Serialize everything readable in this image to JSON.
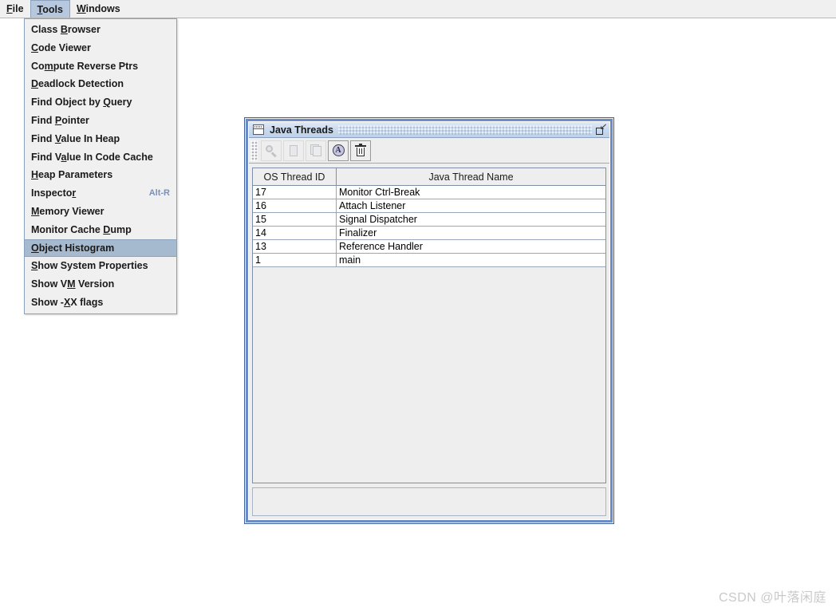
{
  "menubar": {
    "items": [
      {
        "label": "File",
        "mnemonic_index": 0,
        "selected": false
      },
      {
        "label": "Tools",
        "mnemonic_index": 0,
        "selected": true
      },
      {
        "label": "Windows",
        "mnemonic_index": 0,
        "selected": false
      }
    ]
  },
  "tools_menu": {
    "open": true,
    "highlight_color": "#a5b9cf",
    "items": [
      {
        "label": "Class Browser",
        "mnemonic_index": 6,
        "accel": "",
        "highlighted": false
      },
      {
        "label": "Code Viewer",
        "mnemonic_index": 0,
        "accel": "",
        "highlighted": false
      },
      {
        "label": "Compute Reverse Ptrs",
        "mnemonic_index": 2,
        "accel": "",
        "highlighted": false
      },
      {
        "label": "Deadlock Detection",
        "mnemonic_index": 0,
        "accel": "",
        "highlighted": false
      },
      {
        "label": "Find Object by Query",
        "mnemonic_index": 15,
        "accel": "",
        "highlighted": false
      },
      {
        "label": "Find Pointer",
        "mnemonic_index": 5,
        "accel": "",
        "highlighted": false
      },
      {
        "label": "Find Value In Heap",
        "mnemonic_index": 5,
        "accel": "",
        "highlighted": false
      },
      {
        "label": "Find Value In Code Cache",
        "mnemonic_index": 6,
        "accel": "",
        "highlighted": false
      },
      {
        "label": "Heap Parameters",
        "mnemonic_index": 0,
        "accel": "",
        "highlighted": false
      },
      {
        "label": "Inspector",
        "mnemonic_index": 8,
        "accel": "Alt-R",
        "highlighted": false
      },
      {
        "label": "Memory Viewer",
        "mnemonic_index": 0,
        "accel": "",
        "highlighted": false
      },
      {
        "label": "Monitor Cache Dump",
        "mnemonic_index": 14,
        "accel": "",
        "highlighted": false
      },
      {
        "label": "Object Histogram",
        "mnemonic_index": 0,
        "accel": "",
        "highlighted": true
      },
      {
        "label": "Show System Properties",
        "mnemonic_index": 0,
        "accel": "",
        "highlighted": false
      },
      {
        "label": "Show VM Version",
        "mnemonic_index": 6,
        "accel": "",
        "highlighted": false
      },
      {
        "label": "Show -XX flags",
        "mnemonic_index": 6,
        "accel": "",
        "highlighted": false
      }
    ]
  },
  "java_threads_window": {
    "title": "Java Threads",
    "window_icon": "window-icon",
    "maximize_button": "maximize-restore-icon",
    "toolbar": {
      "buttons": [
        {
          "name": "search-icon",
          "enabled": false
        },
        {
          "name": "document-icon",
          "enabled": false
        },
        {
          "name": "documents-icon",
          "enabled": false
        },
        {
          "name": "inspector-icon",
          "enabled": true,
          "glyph": "A"
        },
        {
          "name": "trash-icon",
          "enabled": true
        }
      ]
    },
    "table": {
      "columns": [
        "OS Thread ID",
        "Java Thread Name"
      ],
      "rows": [
        [
          "17",
          "Monitor Ctrl-Break"
        ],
        [
          "16",
          "Attach Listener"
        ],
        [
          "15",
          "Signal Dispatcher"
        ],
        [
          "14",
          "Finalizer"
        ],
        [
          "13",
          "Reference Handler"
        ],
        [
          "1",
          "main"
        ]
      ]
    },
    "statusbar_text": ""
  },
  "watermark": {
    "text": "CSDN @叶落闲庭"
  }
}
